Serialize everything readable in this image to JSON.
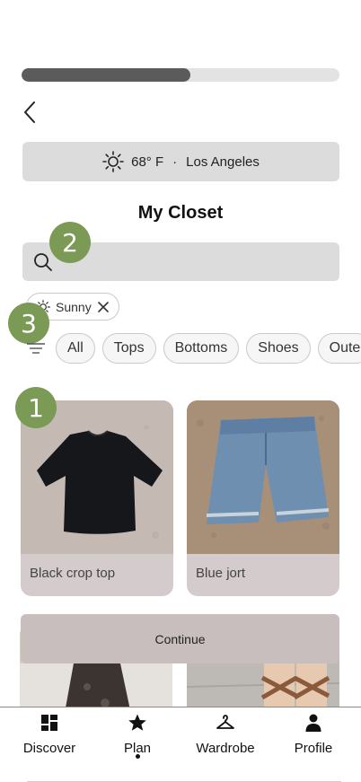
{
  "progress": {
    "fraction": 0.53
  },
  "weather": {
    "temperature": "68° F",
    "separator": "·",
    "location": "Los Angeles"
  },
  "page_title": "My Closet",
  "search": {
    "placeholder": "",
    "value": ""
  },
  "badges": [
    "1",
    "2",
    "3"
  ],
  "active_filter": {
    "label": "Sunny"
  },
  "categories": [
    "All",
    "Tops",
    "Bottoms",
    "Shoes",
    "Oute"
  ],
  "items": [
    {
      "label": "Black crop top"
    },
    {
      "label": "Blue jort"
    }
  ],
  "continue_label": "Continue",
  "nav": {
    "discover": "Discover",
    "plan": "Plan",
    "wardrobe": "Wardrobe",
    "profile": "Profile",
    "active": "Plan"
  },
  "colors": {
    "badge": "#7a9a55",
    "progress_fill": "#5b5b5b",
    "card_bg": "#d4cccc",
    "continue_bg": "#c9bebe"
  },
  "icons": [
    "chevron-left-icon",
    "sun-icon",
    "search-icon",
    "close-icon",
    "filter-icon",
    "grid-icon",
    "star-icon",
    "hanger-icon",
    "person-icon"
  ]
}
